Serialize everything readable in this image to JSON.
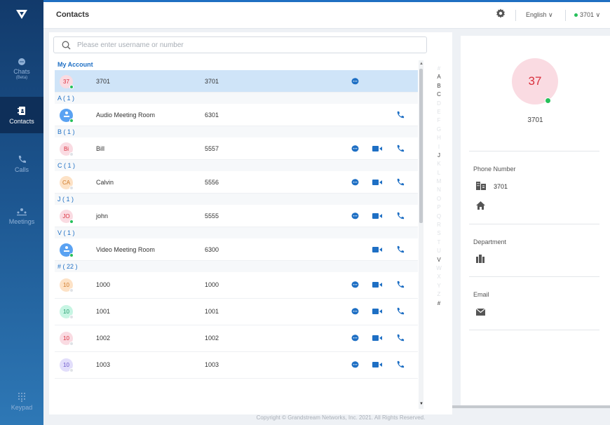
{
  "nav": {
    "chats_label": "Chats",
    "chats_sub": "(Beta)",
    "contacts_label": "Contacts",
    "calls_label": "Calls",
    "meetings_label": "Meetings",
    "keypad_label": "Keypad"
  },
  "header": {
    "title": "Contacts",
    "language": "English",
    "account": "3701"
  },
  "search": {
    "placeholder": "Please enter username or number",
    "value": ""
  },
  "groups": {
    "my_account": "My Account",
    "a": "A ( 1 )",
    "b": "B ( 1 )",
    "c": "C ( 1 )",
    "j": "J ( 1 )",
    "v": "V ( 1 )",
    "hash": "# ( 22 )"
  },
  "contacts": [
    {
      "avatar": "37",
      "name": "3701",
      "number": "3701"
    },
    {
      "avatar": "",
      "name": "Audio Meeting Room",
      "number": "6301"
    },
    {
      "avatar": "Bi",
      "name": "Bill",
      "number": "5557"
    },
    {
      "avatar": "CA",
      "name": "Calvin",
      "number": "5556"
    },
    {
      "avatar": "JO",
      "name": "john",
      "number": "5555"
    },
    {
      "avatar": "",
      "name": "Video Meeting Room",
      "number": "6300"
    },
    {
      "avatar": "10",
      "name": "1000",
      "number": "1000"
    },
    {
      "avatar": "10",
      "name": "1001",
      "number": "1001"
    },
    {
      "avatar": "10",
      "name": "1002",
      "number": "1002"
    },
    {
      "avatar": "10",
      "name": "1003",
      "number": "1003"
    }
  ],
  "alphabet": [
    "#",
    "A",
    "B",
    "C",
    "D",
    "E",
    "F",
    "G",
    "H",
    "I",
    "J",
    "K",
    "L",
    "M",
    "N",
    "O",
    "P",
    "Q",
    "R",
    "S",
    "T",
    "U",
    "V",
    "W",
    "X",
    "Y",
    "Z",
    "#"
  ],
  "alphabet_active": [
    "A",
    "B",
    "C",
    "J",
    "V",
    "#"
  ],
  "detail": {
    "avatar": "37",
    "name": "3701",
    "phone_label": "Phone Number",
    "phone_value": "3701",
    "department_label": "Department",
    "email_label": "Email"
  },
  "footer": "Copyright © Grandstream Networks, Inc. 2021. All Rights Reserved.",
  "colors": {
    "accent": "#1e6fc4",
    "online": "#26c05a",
    "nav_top": "#123a6b"
  }
}
